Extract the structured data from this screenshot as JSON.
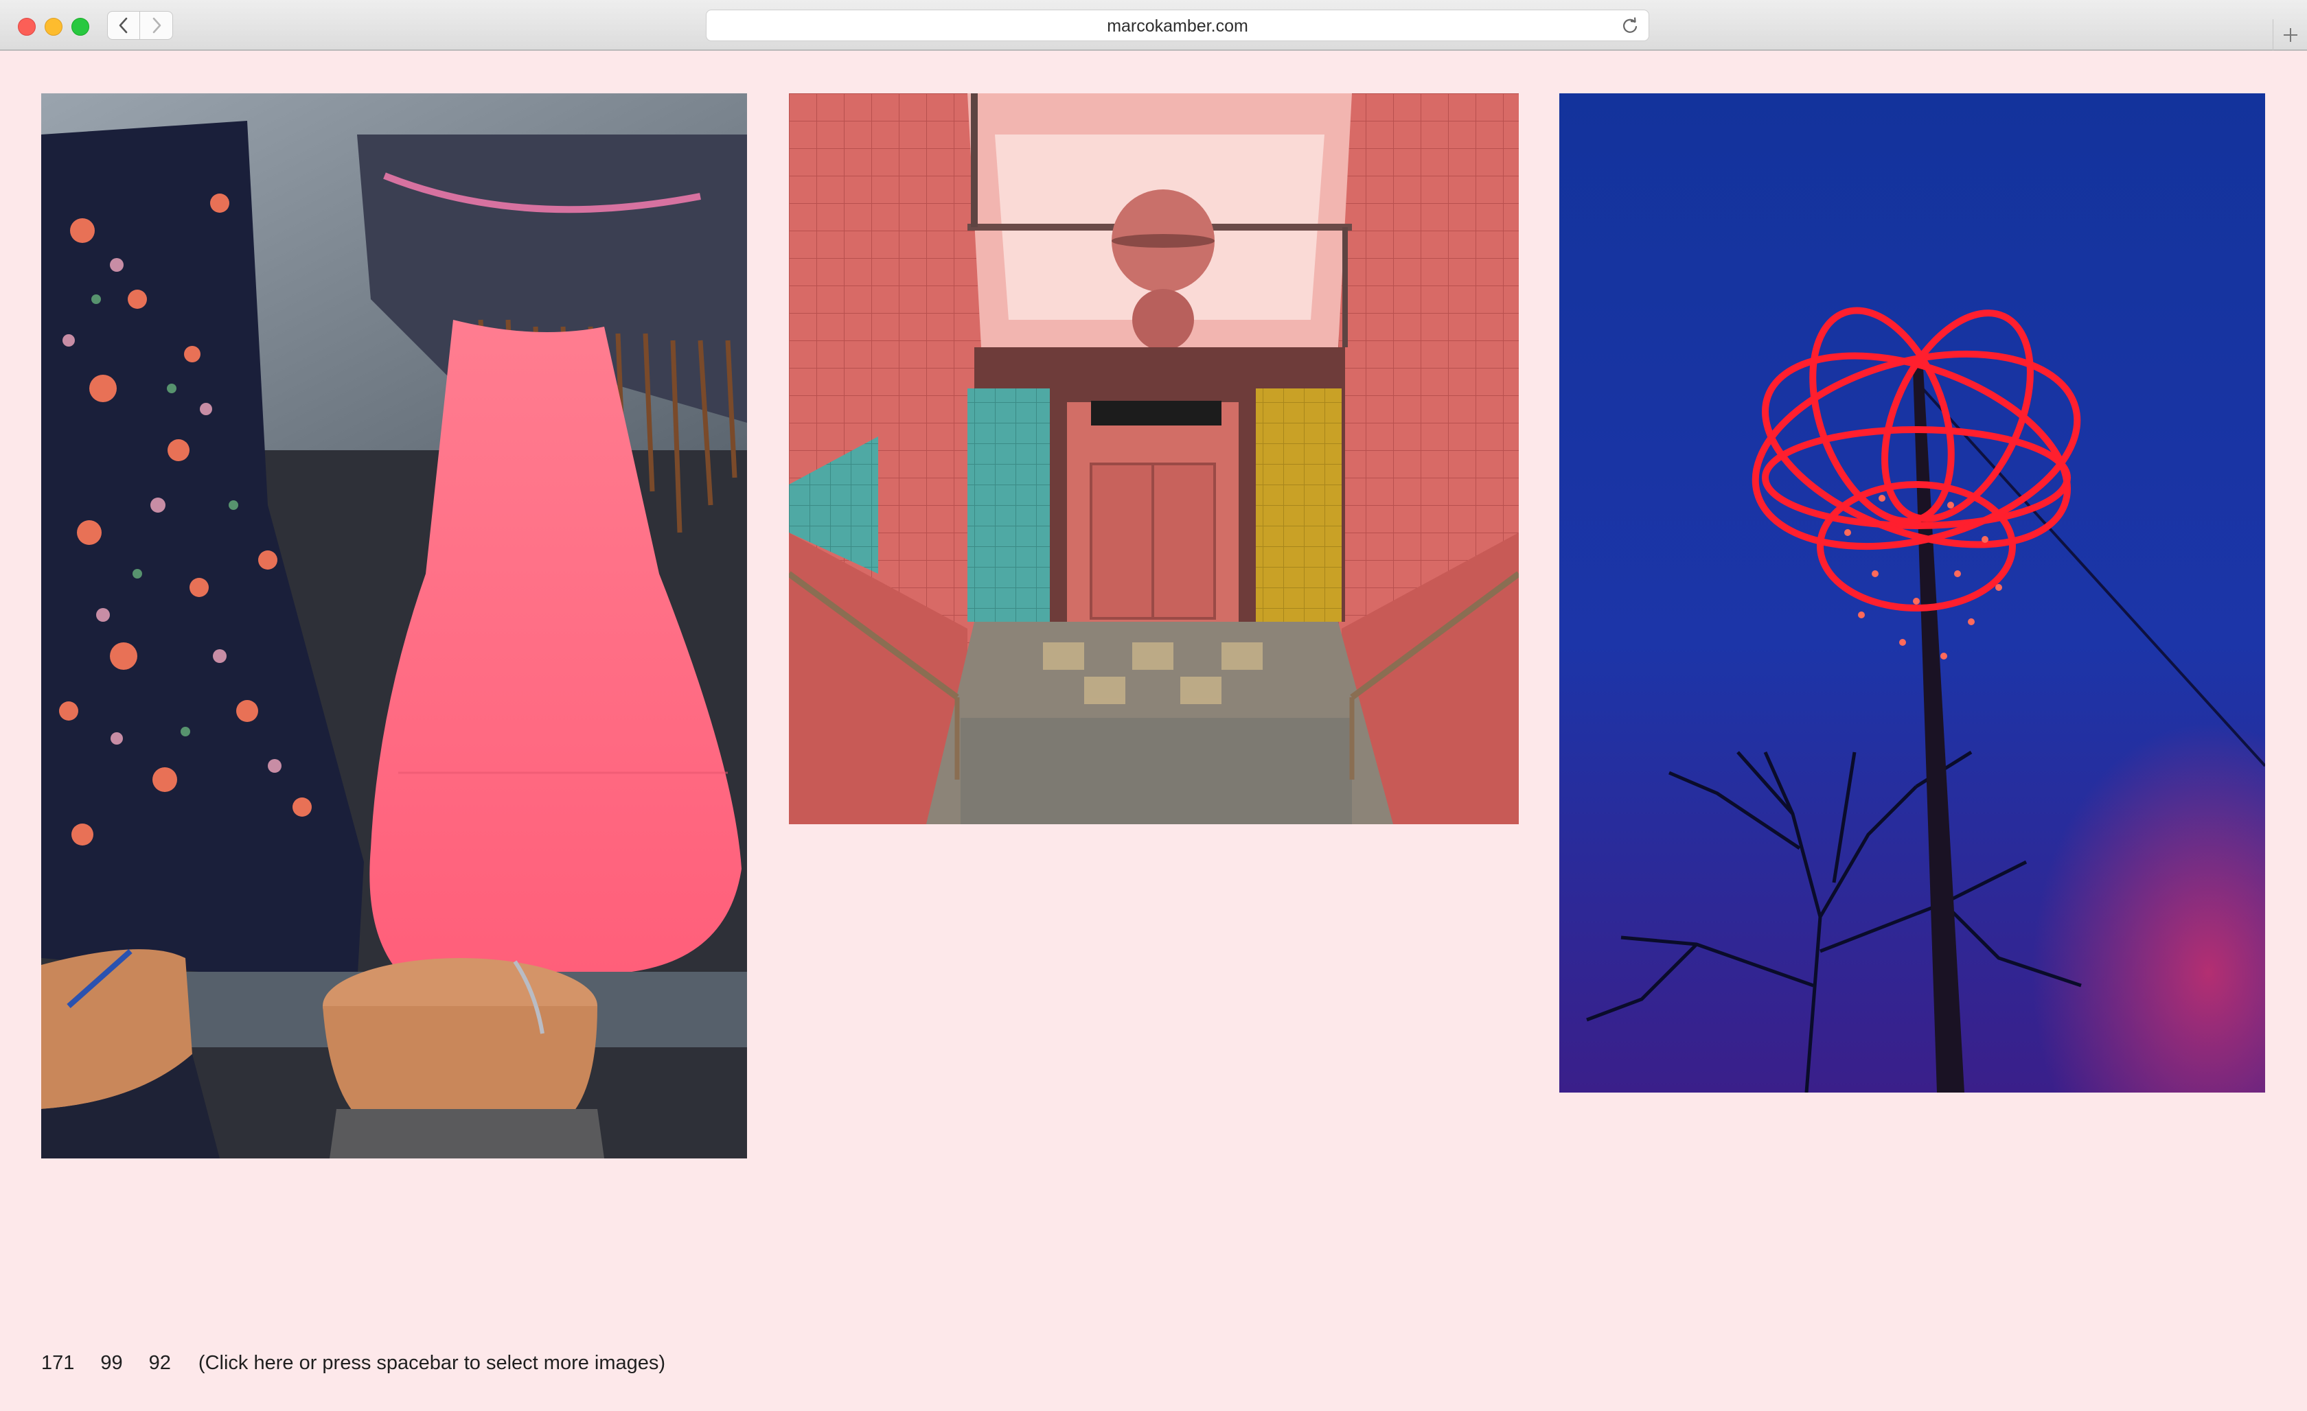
{
  "browser": {
    "url": "marcokamber.com",
    "back_icon": "chevron-left-icon",
    "forward_icon": "chevron-right-icon",
    "reload_icon": "reload-icon",
    "new_tab_icon": "plus-icon"
  },
  "gallery": {
    "images": [
      {
        "description": "Shop window reflection with floral clothing, pink top and mannequin legs"
      },
      {
        "description": "Pink tiled subway stairwell with colored tile panels and hanging globe lamp"
      },
      {
        "description": "Red illuminated light sculpture on pole against blue evening sky with bare tree"
      }
    ]
  },
  "footer": {
    "counts": [
      "171",
      "99",
      "92"
    ],
    "more_text": "(Click here or press spacebar to select more images)"
  },
  "colors": {
    "page_background": "#fde8ea",
    "text": "#1f1f1f"
  }
}
